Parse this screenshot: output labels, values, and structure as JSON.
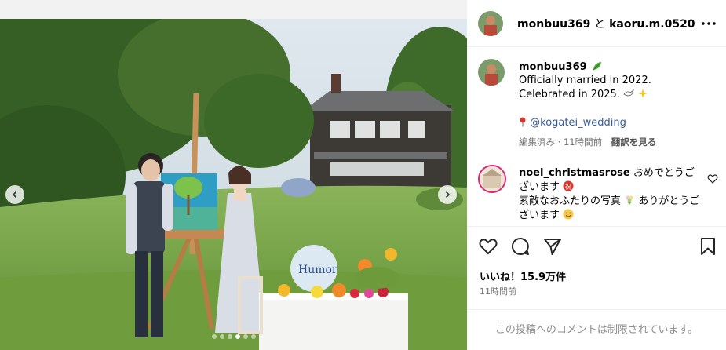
{
  "header": {
    "user1": "monbuu369",
    "joiner": "と",
    "user2": "kaoru.m.0520",
    "more_icon": "more-horizontal-icon"
  },
  "caption": {
    "username": "monbuu369",
    "text": "Officially married in 2022. Celebrated in 2025.",
    "pin_icon": "pin-icon",
    "tag": "@kogatei_wedding",
    "edited": "編集済み · 11時間前",
    "translate": "翻訳を見る"
  },
  "comment": {
    "username": "noel_christmasrose",
    "text1": "おめでとうございます",
    "text2": "素敵なおふたりの写真",
    "text3": "ありがとうございます"
  },
  "photo": {
    "sign_text": "Humor",
    "slide_count": 6,
    "active_slide": 4
  },
  "actions": {
    "like_icon": "heart-icon",
    "comment_icon": "comment-icon",
    "share_icon": "send-icon",
    "save_icon": "bookmark-icon"
  },
  "stats": {
    "likes": "いいね！15.9万件",
    "time": "11時間前"
  },
  "footer": {
    "comments_closed": "この投稿へのコメントは制限されています。"
  },
  "colors": {
    "link": "#375a9c",
    "muted": "#737373",
    "border": "#efefef"
  }
}
